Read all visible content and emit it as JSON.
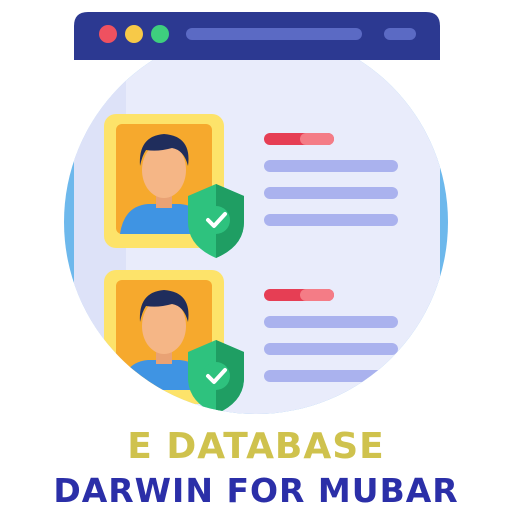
{
  "illustration": {
    "name": "database-profiles-illustration",
    "window_dots": [
      "#ef5160",
      "#f7c948",
      "#3ecf7e"
    ],
    "colors": {
      "bg_circle": "#6db8ec",
      "window_frame": "#2c3991",
      "window_body": "#e9ecfb",
      "bar_light": "#5b6ac4",
      "line": "#aab2ee",
      "red_tag": "#e63e54",
      "red_tag_light": "#f47c86",
      "card_outer": "#fde36a",
      "card_inner": "#f6a92d",
      "skin": "#f5b686",
      "hair": "#1f2d5c",
      "shirt": "#3f94e3",
      "shield": "#2ec27e",
      "shield_dark": "#1f9e63"
    },
    "records": [
      {
        "icon": "user-avatar-icon",
        "badge": "verified-shield-icon"
      },
      {
        "icon": "user-avatar-icon",
        "badge": "verified-shield-icon"
      }
    ]
  },
  "caption": {
    "line1": "E DATABASE",
    "line2": "DARWIN FOR MUBAR",
    "line1_color": "#cfc24d",
    "line2_color": "#2b2fa8"
  }
}
